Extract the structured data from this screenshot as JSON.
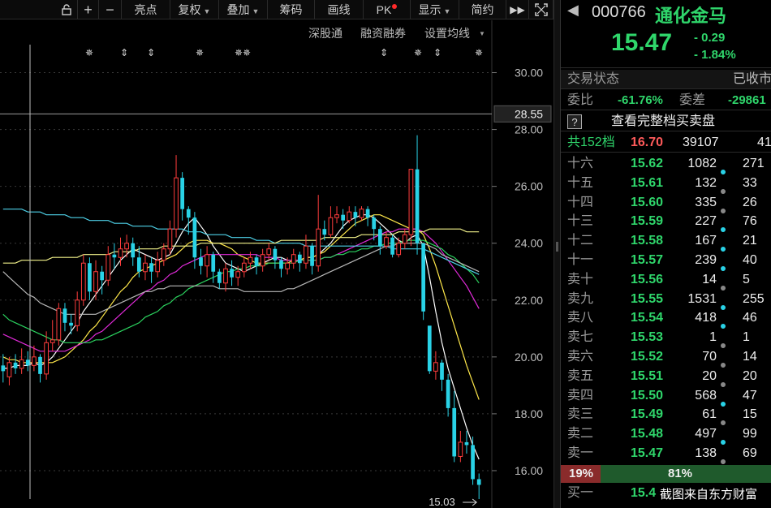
{
  "toolbar": {
    "btn_plus": "+",
    "btn_minus": "−",
    "highlight": "亮点",
    "fq": "复权",
    "overlay": "叠加",
    "chips": "筹码",
    "draw": "画线",
    "pk": "PK",
    "display": "显示",
    "simple": "简约"
  },
  "chart_tools": {
    "sz_connect": "深股通",
    "margin": "融资融券",
    "set_ma": "设置均线"
  },
  "chart_data": {
    "type": "candlestick",
    "y_ticks": [
      "30.00",
      "28.00",
      "26.00",
      "24.00",
      "22.00",
      "20.00",
      "18.00",
      "16.00"
    ],
    "ylim": [
      15.0,
      30.7
    ],
    "current_price_label": "28.55",
    "low_label": "15.03",
    "candles": [
      [
        19.7,
        19.5,
        20.1,
        19.1
      ],
      [
        19.3,
        19.8,
        20.0,
        19.0
      ],
      [
        19.8,
        19.6,
        20.1,
        19.4
      ],
      [
        19.6,
        19.9,
        20.3,
        19.4
      ],
      [
        19.9,
        19.7,
        20.2,
        19.5
      ],
      [
        19.7,
        20.0,
        20.4,
        19.5
      ],
      [
        20.0,
        19.4,
        20.1,
        19.1
      ],
      [
        19.4,
        20.5,
        20.9,
        19.2
      ],
      [
        20.5,
        20.6,
        21.3,
        20.2
      ],
      [
        20.6,
        21.7,
        21.9,
        20.4
      ],
      [
        21.7,
        21.2,
        21.9,
        20.9
      ],
      [
        21.2,
        21.1,
        21.5,
        20.8
      ],
      [
        21.1,
        22.0,
        22.3,
        20.9
      ],
      [
        22.0,
        23.3,
        23.6,
        21.8
      ],
      [
        23.3,
        22.3,
        23.5,
        22.0
      ],
      [
        22.3,
        23.0,
        23.4,
        22.0
      ],
      [
        23.0,
        22.7,
        23.2,
        22.2
      ],
      [
        22.7,
        23.6,
        23.9,
        22.5
      ],
      [
        23.6,
        23.5,
        24.0,
        23.1
      ],
      [
        23.5,
        23.8,
        24.2,
        23.2
      ],
      [
        23.8,
        24.0,
        24.3,
        23.5
      ],
      [
        24.0,
        23.5,
        24.2,
        23.2
      ],
      [
        23.5,
        23.0,
        23.9,
        22.8
      ],
      [
        23.0,
        23.3,
        23.6,
        22.7
      ],
      [
        23.3,
        23.0,
        23.5,
        22.6
      ],
      [
        23.0,
        23.4,
        23.7,
        22.8
      ],
      [
        23.4,
        23.8,
        24.0,
        23.2
      ],
      [
        23.8,
        24.5,
        24.8,
        23.6
      ],
      [
        24.5,
        26.3,
        27.1,
        24.2
      ],
      [
        26.3,
        25.2,
        26.5,
        24.8
      ],
      [
        25.2,
        24.9,
        25.3,
        24.3
      ],
      [
        24.9,
        23.5,
        25.1,
        23.1
      ],
      [
        23.5,
        23.2,
        23.8,
        22.9
      ],
      [
        23.2,
        23.6,
        23.9,
        22.8
      ],
      [
        23.6,
        23.0,
        23.7,
        22.6
      ],
      [
        23.0,
        22.6,
        23.1,
        22.4
      ],
      [
        22.6,
        23.1,
        23.3,
        22.3
      ],
      [
        23.1,
        22.8,
        23.4,
        22.5
      ],
      [
        22.8,
        23.0,
        23.2,
        22.5
      ],
      [
        23.0,
        23.3,
        23.5,
        22.8
      ],
      [
        23.3,
        23.5,
        23.7,
        23.1
      ],
      [
        23.5,
        23.2,
        23.6,
        22.9
      ],
      [
        23.2,
        23.6,
        23.8,
        23.0
      ],
      [
        23.6,
        23.8,
        24.0,
        23.4
      ],
      [
        23.8,
        23.4,
        23.9,
        23.1
      ],
      [
        23.4,
        23.1,
        23.5,
        22.8
      ],
      [
        23.1,
        23.3,
        23.5,
        22.9
      ],
      [
        23.3,
        23.6,
        23.8,
        23.1
      ],
      [
        23.6,
        23.3,
        23.7,
        23.0
      ],
      [
        23.3,
        23.9,
        24.3,
        23.1
      ],
      [
        23.9,
        23.2,
        24.0,
        22.9
      ],
      [
        23.2,
        24.5,
        25.7,
        23.0
      ],
      [
        24.5,
        24.3,
        24.8,
        24.1
      ],
      [
        24.3,
        24.9,
        25.3,
        24.2
      ],
      [
        24.9,
        25.0,
        25.3,
        24.7
      ],
      [
        25.0,
        24.8,
        25.2,
        24.5
      ],
      [
        24.8,
        25.1,
        25.3,
        24.7
      ],
      [
        25.1,
        24.9,
        25.3,
        24.6
      ],
      [
        24.9,
        25.2,
        25.3,
        24.8
      ],
      [
        25.2,
        24.9,
        25.3,
        24.6
      ],
      [
        24.9,
        24.5,
        25.0,
        24.1
      ],
      [
        24.5,
        23.9,
        24.6,
        23.6
      ],
      [
        23.9,
        24.2,
        24.4,
        23.8
      ],
      [
        24.2,
        23.6,
        24.3,
        23.5
      ],
      [
        23.6,
        24.0,
        24.2,
        23.5
      ],
      [
        24.0,
        24.3,
        24.5,
        23.8
      ],
      [
        24.3,
        26.6,
        26.6,
        23.9
      ],
      [
        26.6,
        24.0,
        27.8,
        23.6
      ],
      [
        24.0,
        21.6,
        23.4,
        21.3
      ],
      [
        21.1,
        19.5,
        20.4,
        19.4
      ],
      [
        19.5,
        19.8,
        20.2,
        19.2
      ],
      [
        19.8,
        19.2,
        19.9,
        18.8
      ],
      [
        19.2,
        18.2,
        19.4,
        17.9
      ],
      [
        18.2,
        16.5,
        18.8,
        16.3
      ],
      [
        16.5,
        17.0,
        17.4,
        16.3
      ],
      [
        17.0,
        16.9,
        17.4,
        16.6
      ],
      [
        16.9,
        15.7,
        17.2,
        15.5
      ],
      [
        15.7,
        15.5,
        15.9,
        15.0
      ]
    ],
    "ma_series": [
      {
        "color": "#ffffff",
        "values": [
          19.6,
          19.6,
          19.7,
          19.7,
          19.7,
          19.8,
          19.7,
          19.8,
          20.0,
          20.3,
          20.6,
          20.9,
          21.2,
          21.6,
          21.9,
          22.2,
          22.5,
          22.8,
          23.1,
          23.4,
          23.6,
          23.8,
          23.7,
          23.6,
          23.5,
          23.4,
          23.5,
          23.6,
          24.0,
          24.4,
          24.7,
          24.9,
          24.6,
          24.3,
          23.9,
          23.6,
          23.3,
          23.2,
          23.1,
          23.0,
          23.1,
          23.2,
          23.3,
          23.4,
          23.5,
          23.5,
          23.4,
          23.4,
          23.4,
          23.5,
          23.5,
          23.6,
          23.8,
          24.0,
          24.3,
          24.6,
          24.8,
          24.9,
          25.0,
          25.0,
          24.9,
          24.7,
          24.5,
          24.3,
          24.1,
          24.0,
          24.2,
          24.3,
          23.9,
          22.8,
          21.6,
          20.5,
          19.6,
          18.9,
          18.2,
          17.5,
          16.9,
          16.4
        ]
      },
      {
        "color": "#ffe84a",
        "values": [
          20.0,
          19.9,
          19.9,
          19.8,
          19.8,
          19.8,
          19.8,
          19.8,
          19.8,
          19.9,
          20.0,
          20.2,
          20.4,
          20.6,
          20.9,
          21.1,
          21.4,
          21.7,
          22.0,
          22.3,
          22.5,
          22.8,
          23.0,
          23.1,
          23.2,
          23.3,
          23.4,
          23.5,
          23.6,
          23.8,
          24.0,
          24.1,
          24.1,
          24.1,
          24.0,
          24.0,
          23.9,
          23.8,
          23.6,
          23.5,
          23.4,
          23.3,
          23.3,
          23.3,
          23.3,
          23.3,
          23.3,
          23.4,
          23.4,
          23.5,
          23.5,
          23.6,
          23.7,
          23.9,
          24.1,
          24.3,
          24.5,
          24.7,
          24.8,
          24.9,
          25.0,
          25.0,
          24.9,
          24.8,
          24.7,
          24.6,
          24.5,
          24.5,
          24.3,
          23.8,
          23.2,
          22.5,
          21.8,
          21.1,
          20.4,
          19.7,
          19.1,
          18.5
        ]
      },
      {
        "color": "#e02ad8",
        "values": [
          20.8,
          20.7,
          20.6,
          20.5,
          20.4,
          20.3,
          20.2,
          20.2,
          20.2,
          20.2,
          20.2,
          20.3,
          20.4,
          20.5,
          20.6,
          20.8,
          20.9,
          21.1,
          21.3,
          21.5,
          21.7,
          21.9,
          22.1,
          22.3,
          22.4,
          22.6,
          22.7,
          22.9,
          23.0,
          23.2,
          23.3,
          23.4,
          23.5,
          23.6,
          23.6,
          23.6,
          23.6,
          23.6,
          23.6,
          23.6,
          23.6,
          23.6,
          23.5,
          23.5,
          23.5,
          23.4,
          23.4,
          23.4,
          23.4,
          23.4,
          23.4,
          23.4,
          23.5,
          23.5,
          23.6,
          23.7,
          23.8,
          23.9,
          24.0,
          24.1,
          24.2,
          24.3,
          24.4,
          24.4,
          24.5,
          24.5,
          24.5,
          24.5,
          24.4,
          24.2,
          24.0,
          23.7,
          23.4,
          23.1,
          22.8,
          22.5,
          22.1,
          21.7
        ]
      },
      {
        "color": "#2bd35f",
        "values": [
          21.5,
          21.3,
          21.2,
          21.1,
          21.0,
          20.9,
          20.8,
          20.7,
          20.6,
          20.6,
          20.5,
          20.5,
          20.5,
          20.5,
          20.5,
          20.6,
          20.6,
          20.7,
          20.8,
          20.9,
          21.0,
          21.1,
          21.2,
          21.4,
          21.5,
          21.6,
          21.8,
          21.9,
          22.1,
          22.2,
          22.4,
          22.5,
          22.6,
          22.7,
          22.8,
          22.9,
          23.0,
          23.0,
          23.1,
          23.1,
          23.2,
          23.2,
          23.2,
          23.3,
          23.3,
          23.3,
          23.3,
          23.3,
          23.4,
          23.4,
          23.4,
          23.4,
          23.5,
          23.5,
          23.6,
          23.6,
          23.7,
          23.7,
          23.8,
          23.8,
          23.9,
          23.9,
          24.0,
          24.0,
          24.0,
          24.1,
          24.1,
          24.1,
          24.1,
          24.0,
          23.9,
          23.8,
          23.6,
          23.5,
          23.3,
          23.1,
          22.9,
          22.6
        ]
      },
      {
        "color": "#4ed1e8",
        "values": [
          25.2,
          25.2,
          25.2,
          25.2,
          25.1,
          25.1,
          25.1,
          25.0,
          25.0,
          25.0,
          25.0,
          24.9,
          24.9,
          24.9,
          24.8,
          24.8,
          24.8,
          24.8,
          24.7,
          24.7,
          24.7,
          24.6,
          24.6,
          24.6,
          24.6,
          24.5,
          24.5,
          24.5,
          24.5,
          24.5,
          24.4,
          24.4,
          24.4,
          24.3,
          24.3,
          24.3,
          24.3,
          24.2,
          24.2,
          24.2,
          24.2,
          24.1,
          24.1,
          24.1,
          24.0,
          24.0,
          24.0,
          24.0,
          24.0,
          23.9,
          23.9,
          23.9,
          23.9,
          23.9,
          23.9,
          23.9,
          23.9,
          23.9,
          23.9,
          23.9,
          23.9,
          23.9,
          23.9,
          23.8,
          23.8,
          23.8,
          23.8,
          23.8,
          23.8,
          23.7,
          23.6,
          23.5,
          23.4,
          23.3,
          23.2,
          23.1,
          23.0,
          22.9
        ]
      },
      {
        "color": "#f2f28a",
        "values": [
          23.3,
          23.3,
          23.3,
          23.4,
          23.4,
          23.4,
          23.4,
          23.4,
          23.5,
          23.5,
          23.5,
          23.5,
          23.5,
          23.6,
          23.6,
          23.6,
          23.6,
          23.6,
          23.7,
          23.7,
          23.7,
          23.7,
          23.8,
          23.8,
          23.8,
          23.8,
          23.9,
          23.9,
          23.9,
          23.9,
          23.9,
          23.9,
          24.0,
          24.0,
          24.0,
          24.0,
          24.0,
          24.0,
          24.0,
          24.0,
          24.0,
          24.0,
          24.0,
          24.0,
          24.0,
          24.1,
          24.1,
          24.1,
          24.1,
          24.1,
          24.1,
          24.1,
          24.2,
          24.2,
          24.2,
          24.2,
          24.2,
          24.2,
          24.3,
          24.3,
          24.3,
          24.3,
          24.3,
          24.3,
          24.4,
          24.4,
          24.4,
          24.4,
          24.4,
          24.5,
          24.5,
          24.5,
          24.5,
          24.5,
          24.5,
          24.4,
          24.4,
          24.4
        ]
      },
      {
        "color": "#b8b8b8",
        "values": [
          23.0,
          22.8,
          22.6,
          22.4,
          22.2,
          22.1,
          21.9,
          21.8,
          21.7,
          21.6,
          21.5,
          21.5,
          21.5,
          21.5,
          21.5,
          21.5,
          21.6,
          21.7,
          21.8,
          21.9,
          22.0,
          22.1,
          22.2,
          22.3,
          22.3,
          22.4,
          22.4,
          22.5,
          22.5,
          22.5,
          22.5,
          22.5,
          22.5,
          22.5,
          22.5,
          22.4,
          22.4,
          22.4,
          22.4,
          22.3,
          22.3,
          22.3,
          22.3,
          22.3,
          22.3,
          22.3,
          22.4,
          22.4,
          22.5,
          22.6,
          22.7,
          22.8,
          22.9,
          23.0,
          23.1,
          23.2,
          23.3,
          23.4,
          23.5,
          23.6,
          23.7,
          23.8,
          23.9,
          23.9,
          24.0,
          24.0,
          24.0,
          24.0,
          24.0,
          23.9,
          23.8,
          23.6,
          23.5,
          23.4,
          23.3,
          23.2,
          23.1,
          23.0
        ]
      }
    ],
    "event_markers": [
      "✵",
      "⇕",
      "⇕",
      "✵",
      "✵✵",
      "⇕",
      "✵",
      "⇕",
      "✵"
    ]
  },
  "quote": {
    "code": "000766",
    "name": "通化金马",
    "price": "15.47",
    "change": "- 0.29",
    "change_pct": "- 1.84%"
  },
  "status": {
    "label": "交易状态",
    "value": "已收市"
  },
  "ratio": {
    "label1": "委比",
    "value1": "-61.76%",
    "label2": "委差",
    "value2": "-29861"
  },
  "fullbook": {
    "label": "查看完整档买卖盘"
  },
  "level_total": {
    "label": "共152档",
    "price": "16.70",
    "volume": "39107",
    "extra": "41"
  },
  "levels": [
    {
      "label": "十六",
      "price": "15.62",
      "volume": "1082",
      "dot": "cyan",
      "extra": "271"
    },
    {
      "label": "十五",
      "price": "15.61",
      "volume": "132",
      "dot": "gray",
      "extra": "33"
    },
    {
      "label": "十四",
      "price": "15.60",
      "volume": "335",
      "dot": "gray",
      "extra": "26"
    },
    {
      "label": "十三",
      "price": "15.59",
      "volume": "227",
      "dot": "cyan",
      "extra": "76"
    },
    {
      "label": "十二",
      "price": "15.58",
      "volume": "167",
      "dot": "cyan",
      "extra": "21"
    },
    {
      "label": "十一",
      "price": "15.57",
      "volume": "239",
      "dot": "cyan",
      "extra": "40"
    },
    {
      "label": "卖十",
      "price": "15.56",
      "volume": "14",
      "dot": "gray",
      "extra": "5"
    },
    {
      "label": "卖九",
      "price": "15.55",
      "volume": "1531",
      "dot": "cyan",
      "extra": "255"
    },
    {
      "label": "卖八",
      "price": "15.54",
      "volume": "418",
      "dot": "cyan",
      "extra": "46"
    },
    {
      "label": "卖七",
      "price": "15.53",
      "volume": "1",
      "dot": "gray",
      "extra": "1"
    },
    {
      "label": "卖六",
      "price": "15.52",
      "volume": "70",
      "dot": "gray",
      "extra": "14"
    },
    {
      "label": "卖五",
      "price": "15.51",
      "volume": "20",
      "dot": "gray",
      "extra": "20"
    },
    {
      "label": "卖四",
      "price": "15.50",
      "volume": "568",
      "dot": "cyan",
      "extra": "47"
    },
    {
      "label": "卖三",
      "price": "15.49",
      "volume": "61",
      "dot": "gray",
      "extra": "15"
    },
    {
      "label": "卖二",
      "price": "15.48",
      "volume": "497",
      "dot": "cyan",
      "extra": "99"
    },
    {
      "label": "卖一",
      "price": "15.47",
      "volume": "138",
      "dot": "gray",
      "extra": "69"
    }
  ],
  "strength": {
    "left_pct": "19%",
    "right_pct": "81%",
    "left_fraction": 0.19
  },
  "buy1": {
    "label": "买一",
    "price": "15.4"
  },
  "watermark": "截图来自东方财富",
  "colors": {
    "up": "#ff3d3d",
    "down": "#29d2e6",
    "green": "#2fd66b",
    "red": "#ff4040"
  }
}
